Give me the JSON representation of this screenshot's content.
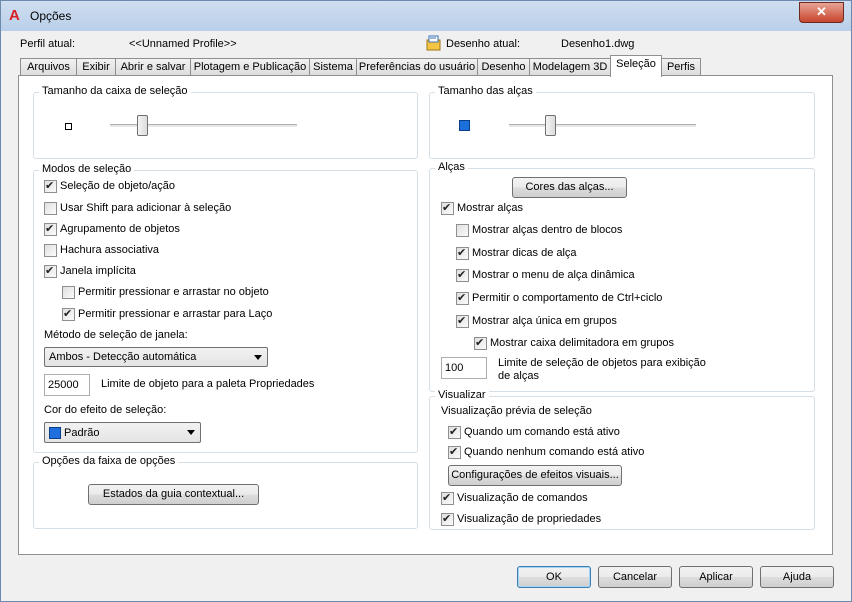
{
  "window": {
    "title": "Opções",
    "close_glyph": "✕"
  },
  "profile": {
    "label": "Perfil atual:",
    "value": "<<Unnamed Profile>>"
  },
  "drawing": {
    "label": "Desenho atual:",
    "value": "Desenho1.dwg"
  },
  "tabs": [
    {
      "label": "Arquivos"
    },
    {
      "label": "Exibir"
    },
    {
      "label": "Abrir e salvar"
    },
    {
      "label": "Plotagem e Publicação"
    },
    {
      "label": "Sistema"
    },
    {
      "label": "Preferências do usuário"
    },
    {
      "label": "Desenho"
    },
    {
      "label": "Modelagem 3D"
    },
    {
      "label": "Seleção",
      "active": true
    },
    {
      "label": "Perfis"
    }
  ],
  "pickbox": {
    "title": "Tamanho da caixa de seleção",
    "slider_value": 0.2
  },
  "grip_size": {
    "title": "Tamanho das alças",
    "slider_value": 0.22
  },
  "selection_modes": {
    "title": "Modos de seleção",
    "items": [
      {
        "label": "Seleção de objeto/ação",
        "checked": true
      },
      {
        "label": "Usar Shift para adicionar à seleção",
        "checked": false
      },
      {
        "label": "Agrupamento de objetos",
        "checked": true
      },
      {
        "label": "Hachura associativa",
        "checked": false
      },
      {
        "label": "Janela implícita",
        "checked": true
      },
      {
        "label": "Permitir pressionar e arrastar no objeto",
        "checked": false
      },
      {
        "label": "Permitir pressionar e arrastar para Laço",
        "checked": true
      }
    ],
    "window_method_label": "Método de seleção de janela:",
    "window_method_value": "Ambos - Detecção automática",
    "object_limit_value": "25000",
    "object_limit_label": "Limite de objeto para a paleta Propriedades",
    "effect_color_label": "Cor do efeito de seleção:",
    "effect_color_value": "Padrão",
    "effect_color_swatch": "#1f6fdc"
  },
  "ribbon_options": {
    "title": "Opções da faixa de opções",
    "button": "Estados da guia contextual..."
  },
  "grips": {
    "title": "Alças",
    "colors_button": "Cores das alças...",
    "items": [
      {
        "label": "Mostrar alças",
        "checked": true
      },
      {
        "label": "Mostrar alças dentro de blocos",
        "checked": false
      },
      {
        "label": "Mostrar dicas de alça",
        "checked": true
      },
      {
        "label": "Mostrar o menu de alça dinâmica",
        "checked": true
      },
      {
        "label": "Permitir o comportamento de Ctrl+ciclo",
        "checked": true
      },
      {
        "label": "Mostrar alça única em grupos",
        "checked": true
      },
      {
        "label": "Mostrar caixa delimitadora em grupos",
        "checked": true
      }
    ],
    "limit_value": "100",
    "limit_label_1": "Limite de seleção de objetos para exibição",
    "limit_label_2": "de alças"
  },
  "preview": {
    "title": "Visualizar",
    "subtitle": "Visualização prévia de seleção",
    "items": [
      {
        "label": "Quando um comando está ativo",
        "checked": true
      },
      {
        "label": "Quando nenhum comando está ativo",
        "checked": true
      }
    ],
    "effects_button": "Configurações de efeitos visuais...",
    "items2": [
      {
        "label": "Visualização de comandos",
        "checked": true
      },
      {
        "label": "Visualização de propriedades",
        "checked": true
      }
    ]
  },
  "footer": {
    "ok": "OK",
    "cancel": "Cancelar",
    "apply": "Aplicar",
    "help": "Ajuda"
  },
  "colors": {
    "grip_blue": "#1b6fdb",
    "title_red": "#d81f26"
  }
}
